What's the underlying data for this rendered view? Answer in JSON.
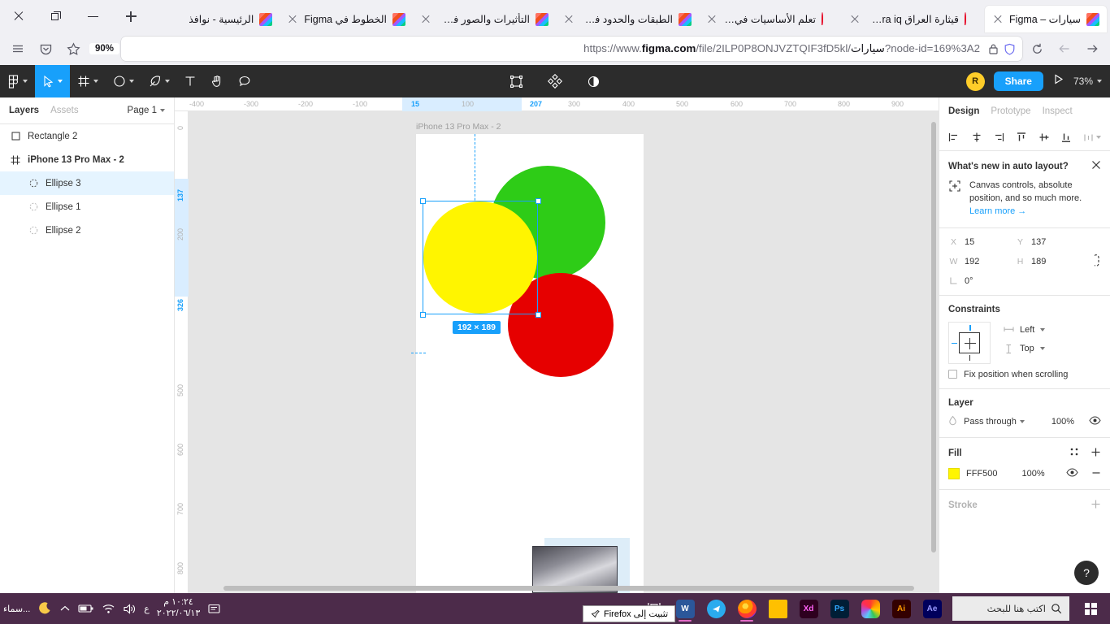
{
  "browser": {
    "window_controls": {
      "close": "close-icon",
      "restore": "restore-icon",
      "minimize": "minimize-icon"
    },
    "new_tab_label": "+",
    "tabs": [
      {
        "title": "سيارات – Figma",
        "favicon": "figma-icon",
        "active": true
      },
      {
        "title": "قيثارة العراق ithara iq",
        "favicon": "pinterest-icon",
        "active": false
      },
      {
        "title": "تعلم الأساسيات في Figma",
        "favicon": "pinterest-icon",
        "active": false
      },
      {
        "title": "الطبقات والحدود في Figma",
        "favicon": "figma-icon",
        "active": false
      },
      {
        "title": "التأثيرات والصور في Figma",
        "favicon": "figma-icon",
        "active": false
      },
      {
        "title": "الخطوط في Figma",
        "favicon": "figma-icon",
        "active": false
      },
      {
        "title": "الرئيسية - نوافذ",
        "favicon": "figma-icon",
        "active": false
      }
    ],
    "nav": {
      "menu_icon": "hamburger-menu-icon",
      "pocket_icon": "pocket-icon",
      "bookmark_icon": "star-icon",
      "zoom_badge": "90%",
      "url_prefix": "https://www.",
      "url_domain": "figma.com",
      "url_path": "/file/2ILP0P8ONJVZTQIF3fD5kl/سيارات",
      "url_query": "?node-id=169%3A2",
      "url_full": "https://www.figma.com/file/2ILP0P8ONJVZTQIF3fD5kl/سيارات?node-id=169%3A2",
      "lock_icon": "padlock-icon",
      "shield_icon": "shield-icon",
      "reload_icon": "reload-icon",
      "back_icon": "back-arrow-icon",
      "forward_icon": "forward-arrow-icon"
    }
  },
  "figma": {
    "toolbar": {
      "menu_icon": "figma-logo-icon",
      "move_icon": "cursor-move-icon",
      "frame_icon": "frame-icon",
      "shape_icon": "ellipse-shape-icon",
      "pen_icon": "pen-icon",
      "text_icon": "text-tool-icon",
      "hand_icon": "hand-tool-icon",
      "comment_icon": "comment-icon",
      "components_icon": "component-icon",
      "plugins_icon": "plugins-icon",
      "theme_icon": "dark-mode-icon",
      "avatar_initial": "R",
      "share_label": "Share",
      "present_icon": "present-play-icon",
      "zoom_level": "73%"
    },
    "left_panel": {
      "tabs": [
        {
          "label": "Layers",
          "active": true
        },
        {
          "label": "Assets",
          "active": false
        }
      ],
      "page_selector": "Page 1",
      "layers": [
        {
          "name": "Rectangle 2",
          "icon": "rectangle-icon",
          "selected": false,
          "indent": false,
          "bold": false
        },
        {
          "name": "iPhone 13 Pro Max - 2",
          "icon": "frame-icon",
          "selected": false,
          "indent": false,
          "bold": true
        },
        {
          "name": "Ellipse 3",
          "icon": "ellipse-icon",
          "selected": true,
          "indent": true,
          "bold": false
        },
        {
          "name": "Ellipse 1",
          "icon": "ellipse-icon",
          "selected": false,
          "indent": true,
          "bold": false
        },
        {
          "name": "Ellipse 2",
          "icon": "ellipse-icon",
          "selected": false,
          "indent": true,
          "bold": false
        }
      ]
    },
    "canvas": {
      "frame_label": "iPhone 13 Pro Max - 2",
      "selection_dimensions": "192 × 189",
      "ruler_h_ticks": [
        "-400",
        "-300",
        "-200",
        "-100",
        "15",
        "100",
        "207",
        "300",
        "400",
        "500",
        "600",
        "700",
        "800",
        "900"
      ],
      "ruler_h_highlight": [
        "15",
        "207"
      ],
      "ruler_v_ticks": [
        "0",
        "137",
        "200",
        "326",
        "500",
        "600",
        "700",
        "800"
      ],
      "ruler_v_highlight": [
        "137",
        "326"
      ],
      "shapes": [
        {
          "name": "green-ellipse",
          "color": "#2ECC17"
        },
        {
          "name": "red-ellipse",
          "color": "#E60000"
        },
        {
          "name": "yellow-ellipse",
          "color": "#FFF500"
        }
      ]
    },
    "right_panel": {
      "tabs": [
        {
          "label": "Design",
          "active": true
        },
        {
          "label": "Prototype",
          "active": false
        },
        {
          "label": "Inspect",
          "active": false
        }
      ],
      "align_icons": [
        "align-left-icon",
        "align-horizontal-center-icon",
        "align-right-icon",
        "align-top-icon",
        "align-vertical-center-icon",
        "align-bottom-icon",
        "distribute-icon"
      ],
      "whats_new": {
        "title": "What's new in auto layout?",
        "close_icon": "close-icon",
        "badge_icon": "absolute-position-icon",
        "body": "Canvas controls, absolute position, and so much more.",
        "link": "Learn more →"
      },
      "properties": {
        "x_label": "X",
        "x_value": "15",
        "y_label": "Y",
        "y_value": "137",
        "w_label": "W",
        "w_value": "192",
        "h_label": "H",
        "h_value": "189",
        "rotation_label": "rotation",
        "rotation_value": "0°",
        "constrain_icon": "constrain-proportions-icon"
      },
      "constraints": {
        "title": "Constraints",
        "horizontal": "Left",
        "vertical": "Top",
        "fix_position_label": "Fix position when scrolling",
        "fix_position_checked": false
      },
      "layer": {
        "title": "Layer",
        "blend_mode": "Pass through",
        "opacity": "100%",
        "visible_icon": "eye-icon"
      },
      "fill": {
        "title": "Fill",
        "styles_icon": "styles-grid-icon",
        "add_icon": "plus-icon",
        "color_hex": "FFF500",
        "color_value": "#FFF500",
        "opacity": "100%",
        "visible_icon": "eye-icon",
        "remove_icon": "minus-icon"
      },
      "stroke": {
        "title": "Stroke",
        "add_icon": "plus-icon"
      },
      "help_fab": "?"
    }
  },
  "taskbar": {
    "start_icon": "windows-logo-icon",
    "search_placeholder": "اكتب هنا للبحث",
    "search_icon": "search-icon",
    "apps": [
      {
        "name": "after-effects",
        "label": "Ae",
        "color": "#00005b",
        "text": "#9999ff",
        "running": false
      },
      {
        "name": "illustrator",
        "label": "Ai",
        "color": "#330000",
        "text": "#ff9a00",
        "running": false
      },
      {
        "name": "creative-cloud",
        "label": "",
        "color": "#df1f26",
        "text": "#fff",
        "running": false
      },
      {
        "name": "photoshop",
        "label": "Ps",
        "color": "#001e36",
        "text": "#31a8ff",
        "running": false
      },
      {
        "name": "xd",
        "label": "Xd",
        "color": "#2e001f",
        "text": "#ff61f6",
        "running": false
      },
      {
        "name": "file-explorer",
        "label": "",
        "color": "#ffc000",
        "text": "#fff",
        "running": false
      },
      {
        "name": "firefox",
        "label": "",
        "color": "#ff5c2b",
        "text": "#fff",
        "running": true
      },
      {
        "name": "telegram",
        "label": "",
        "color": "#2aabee",
        "text": "#fff",
        "running": false
      },
      {
        "name": "word",
        "label": "W",
        "color": "#2b579a",
        "text": "#fff",
        "running": true
      },
      {
        "name": "app-extra",
        "label": "",
        "color": "#4c2b4a",
        "text": "#fff",
        "running": false
      }
    ],
    "tooltip": "تثبيت إلى Firefox",
    "tray": {
      "weather": "سماء...",
      "moon_icon": "moon-icon",
      "chevron_icon": "show-hidden-icons-icon",
      "battery_icon": "battery-icon",
      "wifi_icon": "wifi-icon",
      "volume_icon": "volume-icon",
      "language": "ع",
      "time": "١٠:٢٤ م",
      "date": "٢٠٢٢/٠٦/١٣",
      "notification_icon": "notifications-icon"
    }
  }
}
